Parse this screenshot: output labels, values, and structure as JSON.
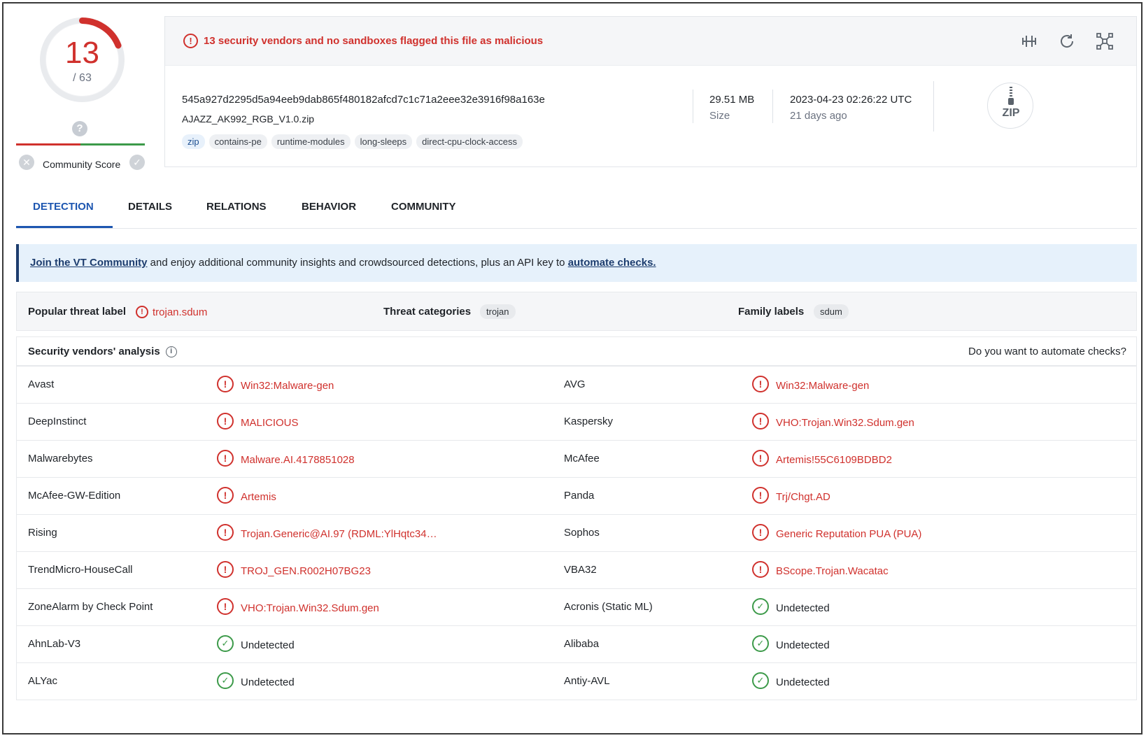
{
  "score": {
    "detections": "13",
    "total": "/ 63"
  },
  "community": {
    "label": "Community Score",
    "unknown_glyph": "?"
  },
  "alert": {
    "text": "13 security vendors and no sandboxes flagged this file as malicious"
  },
  "file": {
    "hash": "545a927d2295d5a94eeb9dab865f480182afcd7c1c71a2eee32e3916f98a163e",
    "name": "AJAZZ_AK992_RGB_V1.0.zip",
    "tags": [
      "zip",
      "contains-pe",
      "runtime-modules",
      "long-sleeps",
      "direct-cpu-clock-access"
    ],
    "size_value": "29.51 MB",
    "size_label": "Size",
    "date_value": "2023-04-23 02:26:22 UTC",
    "date_label": "21 days ago",
    "type_badge": "ZIP"
  },
  "tabs": [
    "DETECTION",
    "DETAILS",
    "RELATIONS",
    "BEHAVIOR",
    "COMMUNITY"
  ],
  "banner": {
    "link1": "Join the VT Community",
    "middle": " and enjoy additional community insights and crowdsourced detections, plus an API key to ",
    "link2": "automate checks."
  },
  "threat": {
    "popular_label": "Popular threat label",
    "popular_value": "trojan.sdum",
    "categories_label": "Threat categories",
    "categories_value": "trojan",
    "family_label": "Family labels",
    "family_value": "sdum"
  },
  "vendors_header": {
    "title": "Security vendors' analysis",
    "automate": "Do you want to automate checks?"
  },
  "vendors": [
    [
      {
        "name": "Avast",
        "result": "Win32:Malware-gen",
        "status": "bad"
      },
      {
        "name": "AVG",
        "result": "Win32:Malware-gen",
        "status": "bad"
      }
    ],
    [
      {
        "name": "DeepInstinct",
        "result": "MALICIOUS",
        "status": "bad"
      },
      {
        "name": "Kaspersky",
        "result": "VHO:Trojan.Win32.Sdum.gen",
        "status": "bad"
      }
    ],
    [
      {
        "name": "Malwarebytes",
        "result": "Malware.AI.4178851028",
        "status": "bad"
      },
      {
        "name": "McAfee",
        "result": "Artemis!55C6109BDBD2",
        "status": "bad"
      }
    ],
    [
      {
        "name": "McAfee-GW-Edition",
        "result": "Artemis",
        "status": "bad"
      },
      {
        "name": "Panda",
        "result": "Trj/Chgt.AD",
        "status": "bad"
      }
    ],
    [
      {
        "name": "Rising",
        "result": "Trojan.Generic@AI.97 (RDML:YlHqtc34…",
        "status": "bad"
      },
      {
        "name": "Sophos",
        "result": "Generic Reputation PUA (PUA)",
        "status": "bad"
      }
    ],
    [
      {
        "name": "TrendMicro-HouseCall",
        "result": "TROJ_GEN.R002H07BG23",
        "status": "bad"
      },
      {
        "name": "VBA32",
        "result": "BScope.Trojan.Wacatac",
        "status": "bad"
      }
    ],
    [
      {
        "name": "ZoneAlarm by Check Point",
        "result": "VHO:Trojan.Win32.Sdum.gen",
        "status": "bad"
      },
      {
        "name": "Acronis (Static ML)",
        "result": "Undetected",
        "status": "ok"
      }
    ],
    [
      {
        "name": "AhnLab-V3",
        "result": "Undetected",
        "status": "ok"
      },
      {
        "name": "Alibaba",
        "result": "Undetected",
        "status": "ok"
      }
    ],
    [
      {
        "name": "ALYac",
        "result": "Undetected",
        "status": "ok"
      },
      {
        "name": "Antiy-AVL",
        "result": "Undetected",
        "status": "ok"
      }
    ]
  ]
}
